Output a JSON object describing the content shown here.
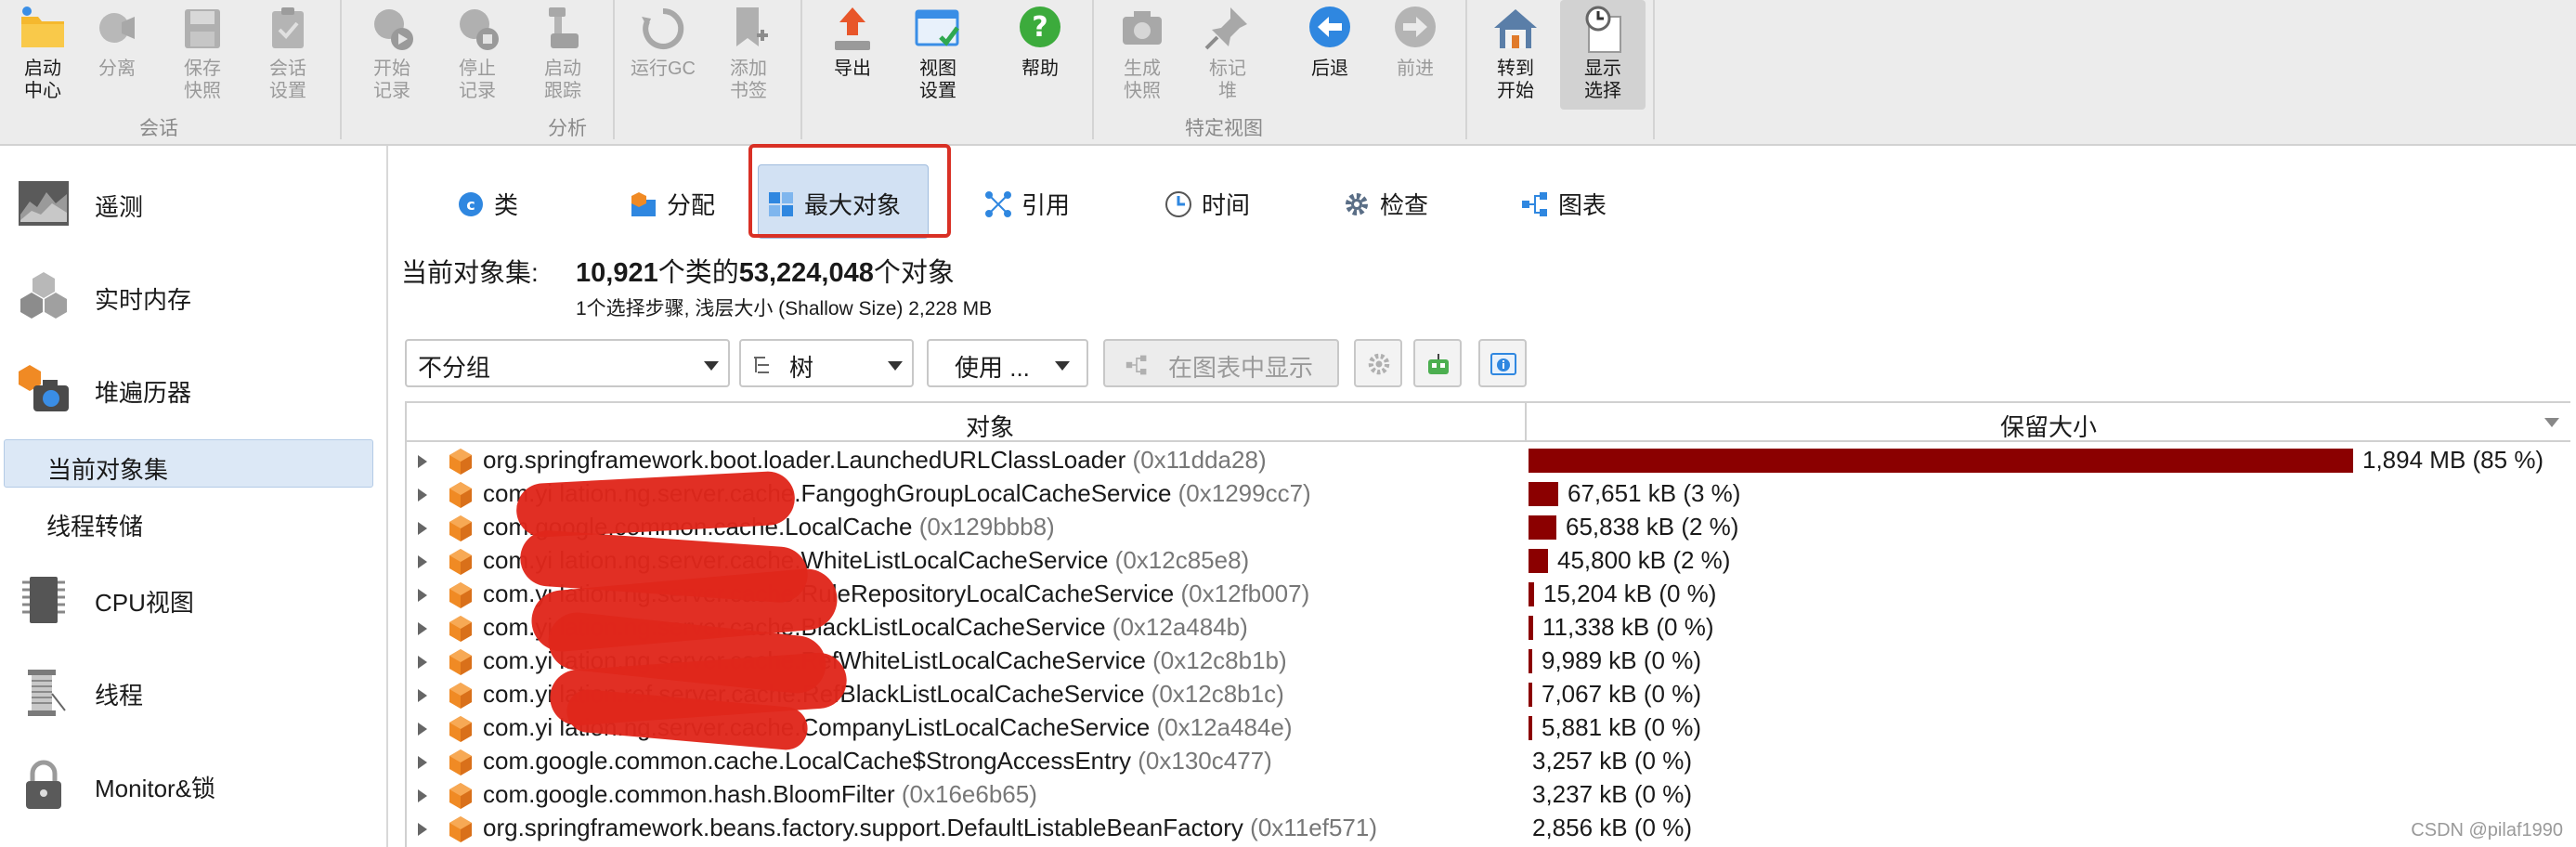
{
  "toolbar": {
    "buttons": [
      {
        "label": "启动\n中心",
        "icon": "start-center-icon"
      },
      {
        "label": "分离",
        "icon": "detach-icon"
      },
      {
        "label": "保存\n快照",
        "icon": "save-snapshot-icon"
      },
      {
        "label": "会话\n设置",
        "icon": "session-settings-icon"
      },
      {
        "label": "开始\n记录",
        "icon": "start-recording-icon"
      },
      {
        "label": "停止\n记录",
        "icon": "stop-recording-icon"
      },
      {
        "label": "启动\n跟踪",
        "icon": "start-tracking-icon"
      },
      {
        "label": "运行GC",
        "icon": "run-gc-icon"
      },
      {
        "label": "添加\n书签",
        "icon": "add-bookmark-icon"
      },
      {
        "label": "导出",
        "icon": "export-icon"
      },
      {
        "label": "视图\n设置",
        "icon": "view-settings-icon"
      },
      {
        "label": "帮助",
        "icon": "help-icon"
      },
      {
        "label": "生成\n快照",
        "icon": "create-snapshot-icon"
      },
      {
        "label": "标记\n堆",
        "icon": "mark-heap-icon"
      },
      {
        "label": "后退",
        "icon": "back-icon"
      },
      {
        "label": "前进",
        "icon": "forward-icon"
      },
      {
        "label": "转到\n开始",
        "icon": "go-to-start-icon"
      },
      {
        "label": "显示\n选择",
        "icon": "show-selection-icon"
      }
    ],
    "groups": [
      "会话",
      "分析",
      "特定视图"
    ]
  },
  "sidebar": {
    "items": [
      {
        "label": "遥测",
        "icon": "telemetry-icon"
      },
      {
        "label": "实时内存",
        "icon": "live-memory-icon"
      },
      {
        "label": "堆遍历器",
        "icon": "heap-walker-icon"
      },
      {
        "label": "当前对象集"
      },
      {
        "label": "线程转储"
      },
      {
        "label": "CPU视图",
        "icon": "cpu-views-icon"
      },
      {
        "label": "线程",
        "icon": "threads-icon"
      },
      {
        "label": "Monitor&锁",
        "icon": "monitor-lock-icon"
      }
    ]
  },
  "tabs": [
    {
      "label": "类",
      "icon": "class-icon"
    },
    {
      "label": "分配",
      "icon": "allocation-icon"
    },
    {
      "label": "最大对象",
      "icon": "biggest-objects-icon"
    },
    {
      "label": "引用",
      "icon": "references-icon"
    },
    {
      "label": "时间",
      "icon": "time-icon"
    },
    {
      "label": "检查",
      "icon": "inspections-icon"
    },
    {
      "label": "图表",
      "icon": "graph-icon"
    }
  ],
  "summary": {
    "label": "当前对象集:",
    "classes": "10,921",
    "text1": "个类的",
    "objects": "53,224,048",
    "text2": "个对象",
    "sub": "1个选择步骤, 浅层大小 (Shallow Size) 2,228 MB"
  },
  "controls": {
    "grouping": "不分组",
    "view": "树",
    "use": "使用 ...",
    "show_in_graph": "在图表中显示"
  },
  "table": {
    "columns": [
      "对象",
      "保留大小"
    ],
    "rows": [
      {
        "name": "org.springframework.boot.loader.LaunchedURLClassLoader",
        "addr": "(0x11dda28)",
        "value": "1,894 MB (85 %)",
        "pct": 85
      },
      {
        "name": "com.yi                 lation.ng.server.cache.FangoghGroupLocalCacheService",
        "addr": "(0x1299cc7)",
        "value": "67,651 kB (3 %)",
        "pct": 3.1
      },
      {
        "name": "com.google.common.cache.LocalCache",
        "addr": "(0x129bbb8)",
        "value": "65,838 kB (2 %)",
        "pct": 2.9
      },
      {
        "name": "com.yi                 lation.ng.server.cache.WhiteListLocalCacheService",
        "addr": "(0x12c85e8)",
        "value": "45,800 kB (2 %)",
        "pct": 2.0
      },
      {
        "name": "com.yi                 lation.ng.server.cache.RuleRepositoryLocalCacheService",
        "addr": "(0x12fb007)",
        "value": "15,204 kB (0 %)",
        "pct": 0.6
      },
      {
        "name": "com.yi                 lation.ng.server.cache.BlackListLocalCacheService",
        "addr": "(0x12a484b)",
        "value": "11,338 kB (0 %)",
        "pct": 0.45
      },
      {
        "name": "com.yi                 lation.ng.server.cache.RefWhiteListLocalCacheService",
        "addr": "(0x12c8b1b)",
        "value": "9,989 kB (0 %)",
        "pct": 0.4
      },
      {
        "name": "com.yi                 lation.ref.server.cache.RefBlackListLocalCacheService",
        "addr": "(0x12c8b1c)",
        "value": "7,067 kB (0 %)",
        "pct": 0.3
      },
      {
        "name": "com.yi                 lation.ng.server.cache.CompanyListLocalCacheService",
        "addr": "(0x12a484e)",
        "value": "5,881 kB (0 %)",
        "pct": 0.25
      },
      {
        "name": "com.google.common.cache.LocalCache$StrongAccessEntry",
        "addr": "(0x130c477)",
        "value": "3,257 kB (0 %)",
        "pct": 0
      },
      {
        "name": "com.google.common.hash.BloomFilter",
        "addr": "(0x16e6b65)",
        "value": "3,237 kB (0 %)",
        "pct": 0
      },
      {
        "name": "org.springframework.beans.factory.support.DefaultListableBeanFactory",
        "addr": "(0x11ef571)",
        "value": "2,856 kB (0 %)",
        "pct": 0
      }
    ]
  },
  "watermark": "CSDN @pilaf1990"
}
